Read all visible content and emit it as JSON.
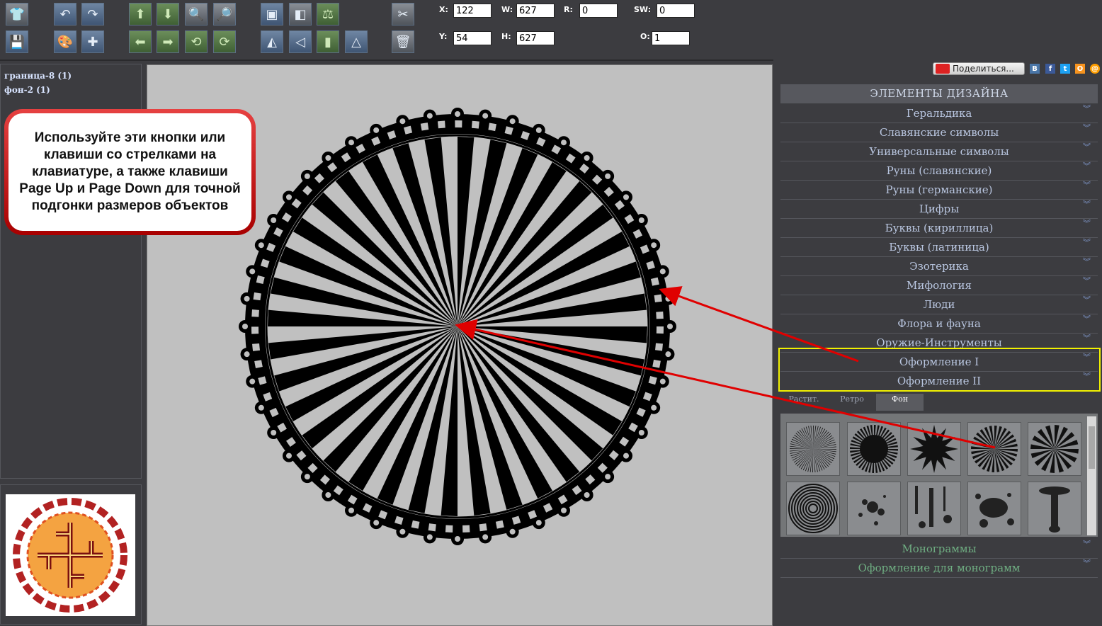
{
  "toolbar": {
    "icons": [
      "shirt-icon",
      "undo-icon",
      "redo-icon",
      "arrow-up-icon",
      "arrow-down-icon",
      "zoom-in-icon",
      "zoom-out-icon",
      "send-back-icon",
      "bring-front-icon",
      "align-icon",
      "tools-icon",
      "save-icon",
      "palette-icon",
      "add-image-icon",
      "arrow-left-icon",
      "arrow-right-icon",
      "rotate-left-icon",
      "rotate-right-icon",
      "flip-horizontal-icon",
      "flip-vertical-icon",
      "mirror-h-icon",
      "mirror-v-icon",
      "delete-icon"
    ],
    "coords": {
      "x_label": "X:",
      "x_value": "122",
      "w_label": "W:",
      "w_value": "627",
      "r_label": "R:",
      "r_value": "0",
      "sw_label": "SW:",
      "sw_value": "0",
      "y_label": "Y:",
      "y_value": "54",
      "h_label": "H:",
      "h_value": "627",
      "o_label": "O:",
      "o_value": "1"
    }
  },
  "layers": [
    "граница-8 (1)",
    "фон-2 (1)"
  ],
  "callout": {
    "text": "Используйте эти кнопки или клавиши со стрелками на клавиатуре, а также клавиши Page Up и Page Down для точной подгонки размеров объектов"
  },
  "share": {
    "label": "Поделиться...",
    "networks": [
      "В",
      "f",
      "t",
      "О",
      "@"
    ],
    "colors": [
      "#4a76a8",
      "#3b5998",
      "#1da1f2",
      "#f7931e",
      "#ff9e00"
    ]
  },
  "design_panel": {
    "header": "ЭЛЕМЕНТЫ ДИЗАЙНА",
    "categories": [
      "Геральдика",
      "Славянские символы",
      "Универсальные символы",
      "Руны (славянские)",
      "Руны (германские)",
      "Цифры",
      "Буквы (кириллица)",
      "Буквы (латиница)",
      "Эзотерика",
      "Мифология",
      "Люди",
      "Флора и фауна",
      "Оружие-Инструменты",
      "Оформление I",
      "Оформление II"
    ],
    "subtabs": [
      "Растит.",
      "Ретро",
      "Фон"
    ],
    "active_subtab": "Фон",
    "bottom_categories": [
      "Монограммы",
      "Оформление для монограмм"
    ],
    "chevron": "︾"
  },
  "colors": {
    "accent_red": "#e00000",
    "highlight_yellow": "#f2f200"
  }
}
